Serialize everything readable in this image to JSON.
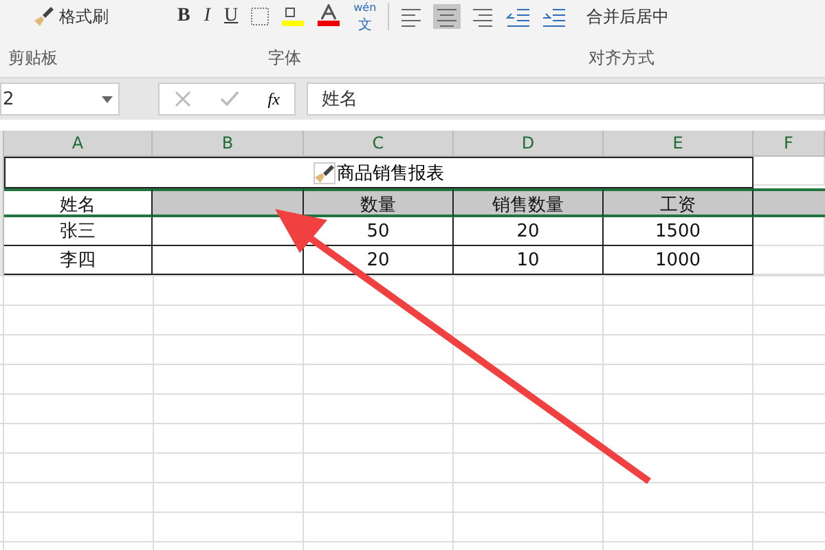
{
  "ribbon": {
    "buttons": [
      {
        "kind": "brush",
        "label": "格式刷"
      },
      {
        "kind": "bold",
        "label": "B"
      },
      {
        "kind": "italic",
        "label": "I"
      },
      {
        "kind": "underline",
        "label": "U"
      }
    ],
    "phonetic": {
      "top": "wén",
      "bottom": "文"
    },
    "merge_button": "合并后居中",
    "groups": [
      "剪贴板",
      "字体",
      "对齐方式"
    ]
  },
  "formula_bar": {
    "name_box": "2",
    "fx": "fx",
    "value": "姓名"
  },
  "columns": [
    "A",
    "B",
    "C",
    "D",
    "E",
    "F"
  ],
  "title_row": {
    "title": "商品销售报表"
  },
  "rows": [
    {
      "selected": true,
      "cells": [
        "姓名",
        "",
        "数量",
        "销售数量",
        "工资"
      ]
    },
    {
      "selected": false,
      "cells": [
        "张三",
        "",
        "50",
        "20",
        "1500"
      ]
    },
    {
      "selected": false,
      "cells": [
        "李四",
        "",
        "20",
        "10",
        "1000"
      ]
    }
  ]
}
